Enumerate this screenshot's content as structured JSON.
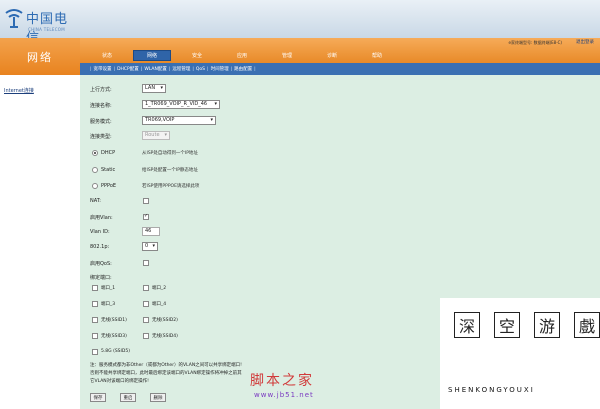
{
  "brand": {
    "logo_text": "中国电信",
    "logo_sub": "CHINA TELECOM"
  },
  "section_title": "网络",
  "device_info": "e家终端型号: 数据终端(E8-C)",
  "logout_label": "退出登录",
  "nav": [
    "状态",
    "网络",
    "安全",
    "应用",
    "管理",
    "诊断",
    "帮助"
  ],
  "nav_active": "网络",
  "subnav": [
    "宽带设置",
    "DHCP配置",
    "WLAN配置",
    "远程管理",
    "QoS",
    "时间管理",
    "路由配置"
  ],
  "sidebar": {
    "item": "Internet连接"
  },
  "form": {
    "uplink_label": "上行方式:",
    "uplink_value": "LAN",
    "conn_name_label": "连接名称:",
    "conn_name_value": "1_TR069_VOIP_R_VID_46",
    "service_mode_label": "服务模式:",
    "service_mode_value": "TR069,VOIP",
    "conn_type_label": "连接类型:",
    "conn_type_value": "Route",
    "dhcp_label": "DHCP",
    "dhcp_desc": "从ISP处自动得到一个IP地址",
    "static_label": "Static",
    "static_desc": "给ISP处配置一个IP静态地址",
    "pppoe_label": "PPPoE",
    "pppoe_desc": "若ISP使用PPPOE请选择此项",
    "nat_label": "NAT:",
    "enable_vlan_label": "启用Vlan:",
    "vlan_id_label": "Vlan ID:",
    "vlan_id_value": "46",
    "dot1p_label": "802.1p:",
    "dot1p_value": "0",
    "enable_qos_label": "启用QoS:",
    "bind_port_label": "绑定端口:",
    "ports": [
      "端口_1",
      "端口_2",
      "端口_3",
      "端口_4",
      "无线(SSID1)",
      "无线(SSID2)",
      "无线(SSID3)",
      "无线(SSID4)",
      "5.8G (SSID5)"
    ],
    "note_1": "注：服务模式都为非Other（或都为Other）的VLAN之间可以共享绑定端口!",
    "note_2": "否则不能共享绑定端口，此时最后绑定该端口的VLAN绑定操作将冲掉之前其",
    "note_3": "它VLAN对该端口的绑定操作!",
    "buttons": {
      "save": "保存",
      "reset": "重启",
      "delete": "删除"
    }
  },
  "watermark": {
    "chars": [
      "深",
      "空",
      "游",
      "戲"
    ],
    "letters": "SHENKONGYOUXI",
    "site_name": "脚本之家",
    "site_url": "www.jb51.net"
  },
  "colors": {
    "orange": "#e8831f",
    "blue_nav": "#2f64a8",
    "content_bg": "#dceee3"
  }
}
